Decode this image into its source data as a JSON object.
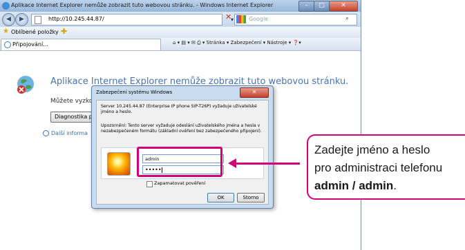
{
  "window": {
    "title": "Aplikace Internet Explorer nemůže zobrazit tuto webovou stránku. - Windows Internet Explorer",
    "min_label": "–",
    "max_label": "□",
    "close_label": "✕"
  },
  "toolbar": {
    "back_icon": "◀",
    "forward_icon": "▶",
    "address": "http://10.245.44.87/",
    "dropdown_icon": "▾",
    "refresh_icon": "↻",
    "stop_icon": "✕",
    "search_placeholder": "Google",
    "search_icon": "⌕"
  },
  "favorites": {
    "label": "Oblíbené položky",
    "star_icon": "★",
    "add_icon": "✚"
  },
  "tab": {
    "label": "Připojování..."
  },
  "command_bar": {
    "text": "⌂ ▾  ▤ ▾  ✉  ⎙ ▾  Stránka ▾  Zabezpečení ▾  Nástroje ▾  ❓▾"
  },
  "page": {
    "error_title": "Aplikace Internet Explorer nemůže zobrazit tuto webovou stránku.",
    "try_text": "Můžete vyzkouše",
    "diag_button": "Diagnostika po",
    "more_info": "Další informa"
  },
  "dialog": {
    "title": "Zabezpečení systému Windows",
    "close_label": "✕",
    "server_msg": "Server 10.245.44.87 (Enterprise IP phone SIP-T26P) vyžaduje uživatelské jméno a heslo.",
    "warning_msg": "Upozornění: Tento server vyžaduje odeslání uživatelského jména a hesla v nezabezpečeném formátu (základní ověření bez zabezpečeného připojení).",
    "username": "admin",
    "password_mask": "•••••",
    "remember_label": "Zapamatovat pověření",
    "ok_label": "OK",
    "cancel_label": "Storno"
  },
  "callout": {
    "line1": "Zadejte jméno a heslo",
    "line2": "pro administraci telefonu",
    "bold": "admin / admin",
    "tail": "."
  },
  "colors": {
    "accent": "#d4007a",
    "link": "#4673b4"
  }
}
